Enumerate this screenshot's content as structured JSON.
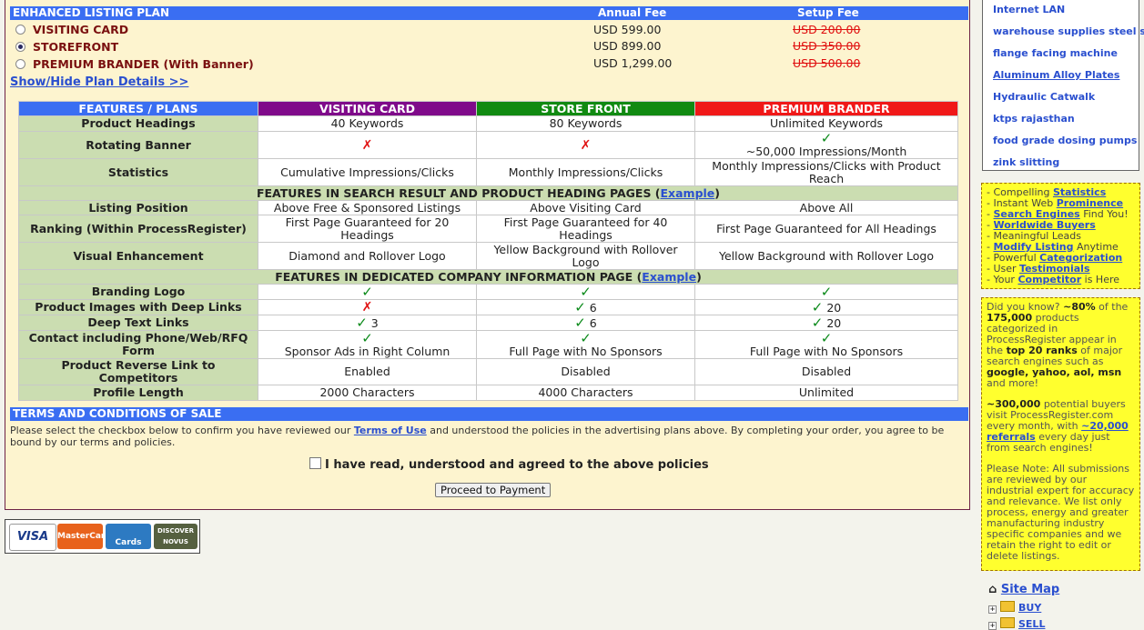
{
  "plan": {
    "header_title": "ENHANCED LISTING PLAN",
    "header_annual": "Annual Fee",
    "header_setup": "Setup Fee",
    "options": [
      {
        "label": "VISITING CARD",
        "annual": "USD 599.00",
        "setup": "USD 200.00",
        "selected": false
      },
      {
        "label": "STOREFRONT",
        "annual": "USD 899.00",
        "setup": "USD 350.00",
        "selected": true
      },
      {
        "label": "PREMIUM BRANDER (With Banner)",
        "annual": "USD 1,299.00",
        "setup": "USD 500.00",
        "selected": false
      }
    ],
    "show_hide": "Show/Hide Plan Details >>"
  },
  "colors": {
    "header_blue": "#3a6ef2",
    "visiting": "#7f0a8a",
    "storefront": "#118a12",
    "premium": "#f01818",
    "label_green": "#cbddb1",
    "check": "#0b8a1a",
    "cross": "#e01010",
    "panel_yellow": "#ffff2e"
  },
  "table": {
    "headers": [
      "FEATURES / PLANS",
      "VISITING CARD",
      "STORE FRONT",
      "PREMIUM BRANDER"
    ],
    "rows1": [
      {
        "label": "Product Headings",
        "v": [
          "40 Keywords",
          "80 Keywords",
          "Unlimited Keywords"
        ]
      },
      {
        "label": "Rotating Banner",
        "v": [
          "",
          "",
          "~50,000 Impressions/Month"
        ]
      },
      {
        "label": "Statistics",
        "v": [
          "Cumulative Impressions/Clicks",
          "Monthly Impressions/Clicks",
          "Monthly Impressions/Clicks with Product Reach"
        ]
      }
    ],
    "section2_text": "FEATURES IN SEARCH RESULT AND PRODUCT HEADING PAGES (",
    "section2_link": "Example",
    "section2_close": ")",
    "rows2": [
      {
        "label": "Listing Position",
        "v": [
          "Above Free & Sponsored Listings",
          "Above Visiting Card",
          "Above All"
        ]
      },
      {
        "label": "Ranking (Within ProcessRegister)",
        "v": [
          "First Page Guaranteed for 20 Headings",
          "First Page Guaranteed for 40 Headings",
          "First Page Guaranteed for All Headings"
        ]
      },
      {
        "label": "Visual Enhancement",
        "v": [
          "Diamond and Rollover Logo",
          "Yellow Background with Rollover Logo",
          "Yellow Background with Rollover Logo"
        ]
      }
    ],
    "section3_text": "FEATURES IN DEDICATED COMPANY INFORMATION PAGE (",
    "section3_link": "Example",
    "section3_close": ")",
    "rows3": [
      {
        "label": "Branding Logo"
      },
      {
        "label": "Product Images with Deep Links",
        "v": [
          "",
          "6",
          "20"
        ]
      },
      {
        "label": "Deep Text Links",
        "v": [
          "3",
          "6",
          "20"
        ]
      },
      {
        "label": "Contact including Phone/Web/RFQ Form",
        "v": [
          "Sponsor Ads in Right Column",
          "Full Page with No Sponsors",
          "Full Page with No Sponsors"
        ]
      },
      {
        "label": "Product Reverse Link to Competitors",
        "v": [
          "Enabled",
          "Disabled",
          "Disabled"
        ]
      },
      {
        "label": "Profile Length",
        "v": [
          "2000 Characters",
          "4000 Characters",
          "Unlimited"
        ]
      }
    ]
  },
  "terms": {
    "title": "TERMS AND CONDITIONS OF SALE",
    "text_before": "Please select the checkbox below to confirm you have reviewed our ",
    "link": "Terms of Use",
    "text_after": " and understood the policies in the advertising plans above. By completing your order, you agree to be bound by our terms and policies.",
    "agree_label": "I have read, understood and agreed to the above policies",
    "proceed": "Proceed to Payment"
  },
  "cards": [
    "VISA",
    "MasterCard",
    "Cards",
    "DISCOVER NOVUS"
  ],
  "sidebar": {
    "keywords": [
      "Internet LAN",
      "warehouse supplies steel st",
      "flange facing machine",
      "Aluminum Alloy Plates",
      "Hydraulic Catwalk",
      "ktps rajasthan",
      "food grade dosing pumps",
      "zink slitting"
    ],
    "features": [
      {
        "pre": "- Compelling ",
        "link": "Statistics",
        "post": ""
      },
      {
        "pre": "- Instant Web ",
        "link": "Prominence",
        "post": ""
      },
      {
        "pre": "- ",
        "link": "Search Engines",
        "post": " Find You!"
      },
      {
        "pre": "- ",
        "link": "Worldwide Buyers",
        "post": ""
      },
      {
        "pre": "- Meaningful Leads",
        "link": "",
        "post": ""
      },
      {
        "pre": "- ",
        "link": "Modify Listing",
        "post": " Anytime"
      },
      {
        "pre": "- Powerful ",
        "link": "Categorization",
        "post": ""
      },
      {
        "pre": "- User ",
        "link": "Testimonials",
        "post": ""
      },
      {
        "pre": "- Your ",
        "link": "Competitor",
        "post": " is Here"
      }
    ],
    "info": {
      "p1a": "Did you know? ",
      "p1b": "~80%",
      "p1c": " of the ",
      "p1d": "175,000",
      "p1e": " products categorized in ProcessRegister appear in the ",
      "p1f": "top 20 ranks",
      "p1g": " of major search engines such as ",
      "p1h": "google, yahoo, aol, msn",
      "p1i": " and more!",
      "p2a": "~300,000",
      "p2b": " potential buyers visit ProcessRegister.com every month, with ",
      "p2c": "~20,000 referrals",
      "p2d": " every day just from search engines!",
      "p3": "Please Note: All submissions are reviewed by our industrial expert for accuracy and relevance. We list only process, energy and greater manufacturing industry specific companies and we retain the right to edit or delete listings."
    },
    "sitemap": "Site Map",
    "tree": [
      "BUY",
      "SELL"
    ]
  }
}
